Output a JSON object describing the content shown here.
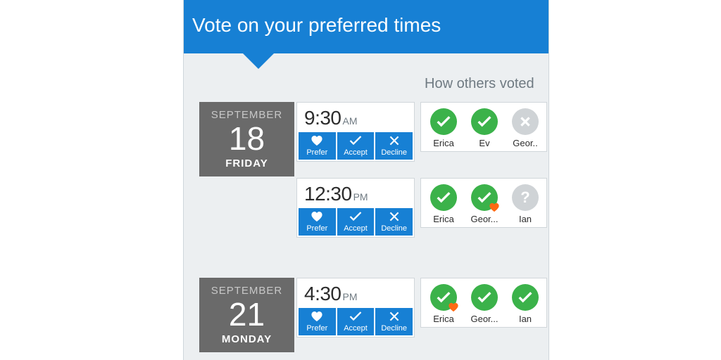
{
  "banner": {
    "title": "Vote on your preferred times"
  },
  "others_header": "How others voted",
  "buttons": {
    "prefer": "Prefer",
    "accept": "Accept",
    "decline": "Decline"
  },
  "days": [
    {
      "month": "SEPTEMBER",
      "day_num": "18",
      "day_name": "FRIDAY",
      "slots": [
        {
          "time": "9:30",
          "ampm": "AM",
          "voters": [
            {
              "name": "Erica",
              "status": "accept",
              "prefer": false
            },
            {
              "name": "Ev",
              "status": "accept",
              "prefer": false
            },
            {
              "name": "Geor..",
              "status": "decline",
              "prefer": false
            }
          ]
        },
        {
          "time": "12:30",
          "ampm": "PM",
          "voters": [
            {
              "name": "Erica",
              "status": "accept",
              "prefer": false
            },
            {
              "name": "Geor...",
              "status": "accept",
              "prefer": true
            },
            {
              "name": "Ian",
              "status": "unknown",
              "prefer": false
            }
          ]
        }
      ]
    },
    {
      "month": "SEPTEMBER",
      "day_num": "21",
      "day_name": "MONDAY",
      "slots": [
        {
          "time": "4:30",
          "ampm": "PM",
          "voters": [
            {
              "name": "Erica",
              "status": "accept",
              "prefer": true
            },
            {
              "name": "Geor...",
              "status": "accept",
              "prefer": false
            },
            {
              "name": "Ian",
              "status": "accept",
              "prefer": false
            }
          ]
        }
      ]
    }
  ]
}
